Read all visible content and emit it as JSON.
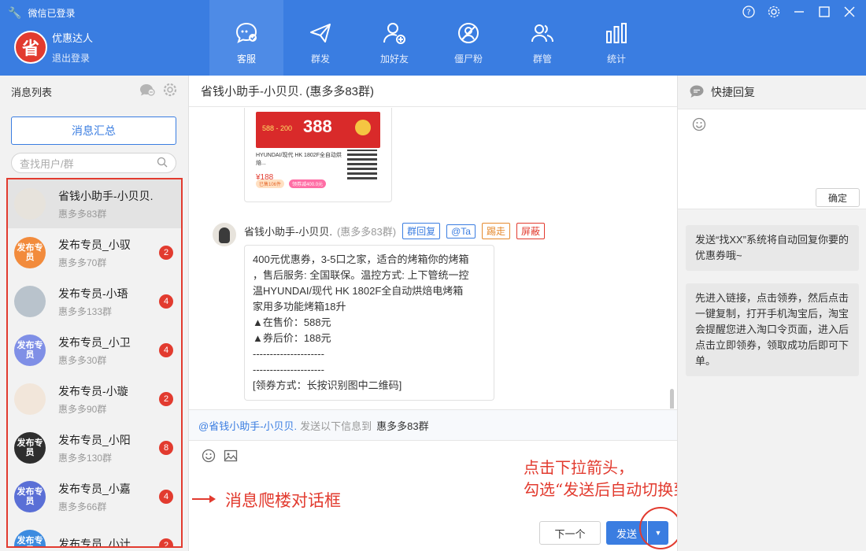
{
  "app": {
    "status": "微信已登录",
    "brand_logo_char": "省",
    "user_name": "优惠达人",
    "logout": "退出登录"
  },
  "nav_tabs": [
    {
      "label": "客服",
      "icon": "chat-check-icon",
      "active": true
    },
    {
      "label": "群发",
      "icon": "paper-plane-icon"
    },
    {
      "label": "加好友",
      "icon": "add-user-icon"
    },
    {
      "label": "僵尸粉",
      "icon": "zombie-fan-icon"
    },
    {
      "label": "群管",
      "icon": "group-manage-icon"
    },
    {
      "label": "统计",
      "icon": "bar-chart-icon"
    }
  ],
  "window_controls": [
    "help-icon",
    "settings-icon",
    "minimize-icon",
    "maximize-icon",
    "close-icon"
  ],
  "sidebar": {
    "title": "消息列表",
    "summary_button": "消息汇总",
    "search_placeholder": "查找用户/群",
    "contacts": [
      {
        "name": "省钱小助手-小贝贝.",
        "group": "惠多多83群",
        "badge": "",
        "avatar_text": "",
        "avatar_color": "#e7e3dc",
        "selected": true
      },
      {
        "name": "发布专员_小驭",
        "group": "惠多多70群",
        "badge": "2",
        "avatar_text": "发布专员",
        "avatar_color": "#f28b3c"
      },
      {
        "name": "发布专员-小珸",
        "group": "惠多多133群",
        "badge": "4",
        "avatar_text": "",
        "avatar_color": "#b9c3cc"
      },
      {
        "name": "发布专员_小卫",
        "group": "惠多多30群",
        "badge": "4",
        "avatar_text": "发布专员",
        "avatar_color": "#7f8fe6"
      },
      {
        "name": "发布专员-小璇",
        "group": "惠多多90群",
        "badge": "2",
        "avatar_text": "",
        "avatar_color": "#f2e6da"
      },
      {
        "name": "发布专员_小阳",
        "group": "惠多多130群",
        "badge": "8",
        "avatar_text": "发布专员",
        "avatar_color": "#2e2e2e"
      },
      {
        "name": "发布专员_小嘉",
        "group": "惠多多66群",
        "badge": "4",
        "avatar_text": "发布专员",
        "avatar_color": "#5a6fd6"
      },
      {
        "name": "发布专员_小计",
        "group": "",
        "badge": "2",
        "avatar_text": "发布专员",
        "avatar_color": "#3c8be0"
      }
    ]
  },
  "chat": {
    "title": "省钱小助手-小贝贝. (惠多多83群)",
    "image_card": {
      "banner_big": "388",
      "banner_small": "588 - 200",
      "title": "HYUNDAI/现代 HK 1802F全自动烘焙...",
      "price": "¥188",
      "tag1": "已售106件",
      "tag2": "领券减400.0元"
    },
    "message": {
      "sender": "省钱小助手-小贝贝.",
      "group": "(惠多多83群)",
      "actions": [
        {
          "label": "群回复",
          "style": "blue"
        },
        {
          "label": "@Ta",
          "style": "blue"
        },
        {
          "label": "踢走",
          "style": "orange"
        },
        {
          "label": "屏蔽",
          "style": "red"
        }
      ],
      "lines": [
        "400元优惠券，3-5口之家，适合的烤箱你的烤箱",
        "，售后服务: 全国联保。温控方式: 上下管统一控",
        "温HYUNDAI/现代 HK 1802F全自动烘焙电烤箱",
        "家用多功能烤箱18升",
        "▲在售价：588元",
        "▲券后价：188元",
        "---------------------",
        "---------------------",
        "[领券方式：长按识别图中二维码]"
      ]
    },
    "notice": {
      "at": "@省钱小助手-小贝贝.",
      "mid": "发送以下信息到",
      "group": "惠多多83群"
    },
    "next_button": "下一个",
    "send_button": "发送",
    "dropdown_glyph": "▼"
  },
  "annotations": {
    "left": "消息爬楼对话框",
    "right_line1": "点击下拉箭头，",
    "right_line2": "勾选“发送后自动切换到下一个用户”"
  },
  "quick_reply": {
    "title": "快捷回复",
    "confirm": "确定",
    "cards": [
      "发送“找XX”系统将自动回复你要的优惠券哦~",
      "先进入链接，点击领券，然后点击一键复制，打开手机淘宝后，淘宝会提醒您进入淘口令页面，进入后点击立即领券，领取成功后即可下单。"
    ]
  }
}
